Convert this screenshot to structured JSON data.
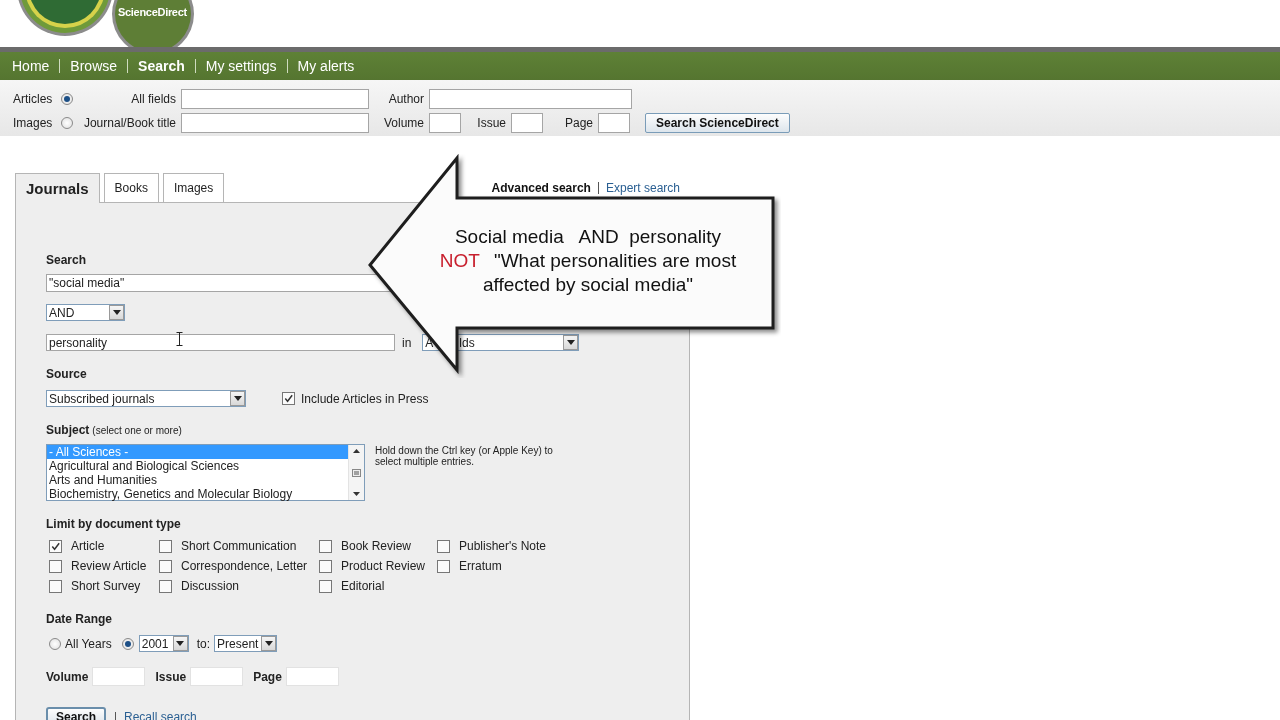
{
  "logo": {
    "text": "ScienceDirect"
  },
  "nav": [
    {
      "label": "Home",
      "selected": false
    },
    {
      "label": "Browse",
      "selected": false
    },
    {
      "label": "Search",
      "selected": true
    },
    {
      "label": "My settings",
      "selected": false
    },
    {
      "label": "My alerts",
      "selected": false
    }
  ],
  "quick_search": {
    "types": [
      {
        "label": "Articles",
        "selected": true
      },
      {
        "label": "Images",
        "selected": false
      }
    ],
    "fields": [
      {
        "label": "All fields"
      },
      {
        "label": "Author"
      },
      {
        "label": "Journal/Book title"
      },
      {
        "label": "Volume"
      },
      {
        "label": "Issue"
      },
      {
        "label": "Page"
      }
    ],
    "button": "Search ScienceDirect"
  },
  "tabs": [
    {
      "label": "Journals",
      "selected": true
    },
    {
      "label": "Books",
      "selected": false
    },
    {
      "label": "Images",
      "selected": false
    }
  ],
  "search_modes": [
    {
      "label": "Advanced search",
      "selected": true
    },
    {
      "label": "Expert search",
      "selected": false
    }
  ],
  "search": {
    "label": "Search",
    "first_term": "\"social media\"",
    "operator": "AND",
    "second_term": "personality",
    "in_label": "in",
    "field_fragments": [
      "A",
      "lds"
    ]
  },
  "source": {
    "label": "Source",
    "value": "Subscribed journals",
    "in_press": {
      "label": "Include Articles in Press",
      "checked": true
    }
  },
  "subject": {
    "label": "Subject",
    "note": "(select one or more)",
    "hint": "Hold down the Ctrl key (or Apple Key) to select multiple entries.",
    "options": [
      {
        "label": "- All Sciences -",
        "selected": true
      },
      {
        "label": "Agricultural and Biological Sciences",
        "selected": false
      },
      {
        "label": "Arts and Humanities",
        "selected": false
      },
      {
        "label": "Biochemistry, Genetics and Molecular Biology",
        "selected": false
      }
    ]
  },
  "doc_types": {
    "label": "Limit by document type",
    "items": [
      {
        "label": "Article",
        "checked": true
      },
      {
        "label": "Short Communication",
        "checked": false
      },
      {
        "label": "Book Review",
        "checked": false
      },
      {
        "label": "Publisher's Note",
        "checked": false
      },
      {
        "label": "Review Article",
        "checked": false
      },
      {
        "label": "Correspondence, Letter",
        "checked": false
      },
      {
        "label": "Product Review",
        "checked": false
      },
      {
        "label": "Erratum",
        "checked": false
      },
      {
        "label": "Short Survey",
        "checked": false
      },
      {
        "label": "Discussion",
        "checked": false
      },
      {
        "label": "Editorial",
        "checked": false
      }
    ]
  },
  "date_range": {
    "label": "Date Range",
    "all_years": {
      "label": "All Years",
      "selected": false
    },
    "from": {
      "value": "2001",
      "selected": true
    },
    "to_label": "to:",
    "to_value": "Present"
  },
  "issue_fields": [
    {
      "label": "Volume"
    },
    {
      "label": "Issue"
    },
    {
      "label": "Page"
    }
  ],
  "actions": {
    "search": "Search",
    "recall": "Recall search"
  },
  "callout": {
    "line_1": "Social media   AND  personality",
    "operator": "NOT",
    "line_2": "\"What personalities are most affected by social media\""
  }
}
